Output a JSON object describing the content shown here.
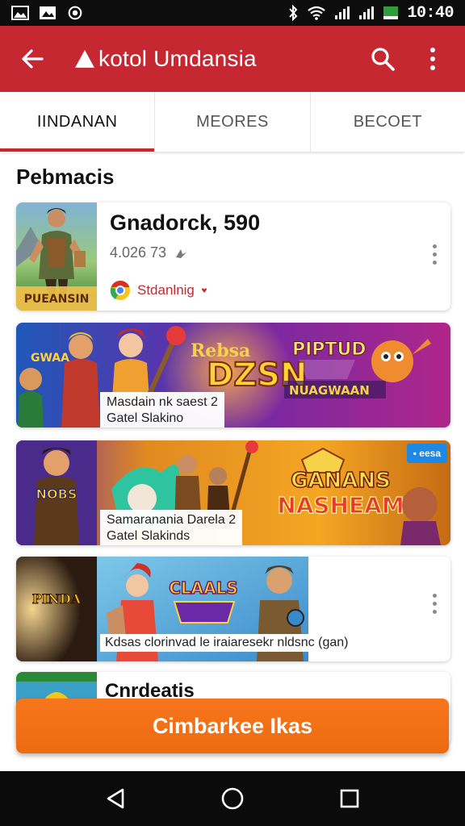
{
  "status_bar": {
    "time": "10:40",
    "left_icons": [
      "image-icon",
      "gallery-icon",
      "camera-icon"
    ],
    "right_icons": [
      "bluetooth-icon",
      "wifi-icon",
      "signal-icon",
      "signal-icon",
      "battery-icon"
    ]
  },
  "app_bar": {
    "title": "kotol Umdansia",
    "logo_icon": "triangle-logo-icon",
    "back_icon": "arrow-back-icon",
    "search_icon": "search-icon",
    "more_icon": "more-vert-icon",
    "color": "#c62832"
  },
  "tabs": [
    {
      "label": "IINDANAN",
      "active": true
    },
    {
      "label": "MEORES",
      "active": false
    },
    {
      "label": "BECOET",
      "active": false
    }
  ],
  "section": {
    "title": "Pebmacis"
  },
  "featured": {
    "title": "Gnadorck, 590",
    "thumbnail_text": "PUEANSIN",
    "meta": "4.026 73",
    "tag": "Stdanlnig"
  },
  "banners": [
    {
      "title_left": "Rebsa",
      "title_main": "DZSN",
      "title_right": "PIPTUD",
      "subtitle": "NUAGWAAN",
      "thumbnail_text": "GWAA",
      "caption_line1": "Masdain nk saest 2",
      "caption_line2": "Gatel Slakino"
    },
    {
      "thumbnail_text": "NOBS",
      "title_main": "GANANS",
      "title_sub": "NASHEAM",
      "chip": "eesa",
      "caption_line1": "Samaranania Darela 2",
      "caption_line2": "Gatel Slakinds"
    },
    {
      "thumbnail_text": "PINDA",
      "art_text": "CLAALS",
      "caption": "Kdsas clorinvad le iraiaresekr nldsnc (gan)"
    }
  ],
  "partial_item": {
    "title": "Cnrdeatis"
  },
  "cta": {
    "label": "Cimbarkee Ikas",
    "color": "#ef6c12"
  },
  "nav": {
    "back_icon": "nav-back-icon",
    "home_icon": "nav-home-icon",
    "recents_icon": "nav-recents-icon"
  }
}
